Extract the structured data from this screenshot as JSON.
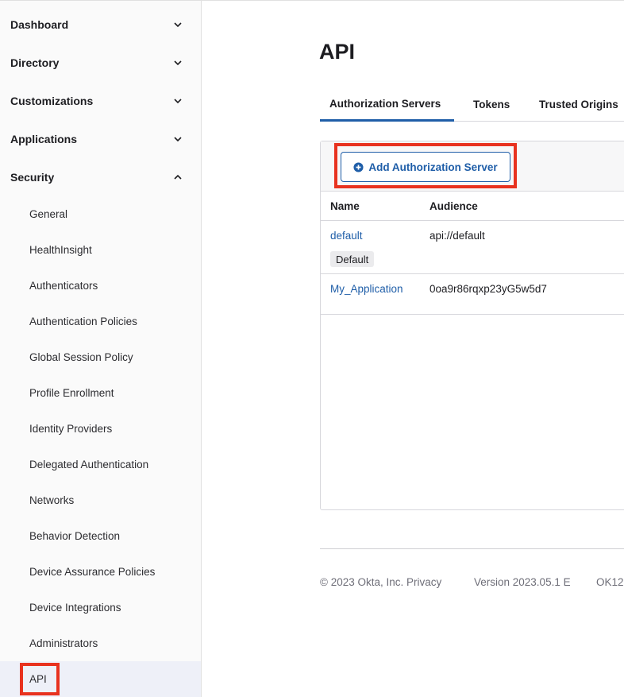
{
  "sidebar": {
    "sections": [
      {
        "label": "Dashboard",
        "expanded": false
      },
      {
        "label": "Directory",
        "expanded": false
      },
      {
        "label": "Customizations",
        "expanded": false
      },
      {
        "label": "Applications",
        "expanded": false
      },
      {
        "label": "Security",
        "expanded": true
      }
    ],
    "security_items": [
      {
        "label": "General"
      },
      {
        "label": "HealthInsight"
      },
      {
        "label": "Authenticators"
      },
      {
        "label": "Authentication Policies"
      },
      {
        "label": "Global Session Policy"
      },
      {
        "label": "Profile Enrollment"
      },
      {
        "label": "Identity Providers"
      },
      {
        "label": "Delegated Authentication"
      },
      {
        "label": "Networks"
      },
      {
        "label": "Behavior Detection"
      },
      {
        "label": "Device Assurance Policies"
      },
      {
        "label": "Device Integrations"
      },
      {
        "label": "Administrators"
      },
      {
        "label": "API",
        "active": true
      }
    ]
  },
  "main": {
    "title": "API",
    "tabs": [
      {
        "label": "Authorization Servers",
        "active": true
      },
      {
        "label": "Tokens"
      },
      {
        "label": "Trusted Origins"
      }
    ],
    "add_button": {
      "label": "Add Authorization Server",
      "icon": "plus-circle-icon"
    },
    "table": {
      "columns": [
        "Name",
        "Audience"
      ],
      "rows": [
        {
          "name": "default",
          "audience": "api://default",
          "badge": "Default"
        },
        {
          "name": "My_Application",
          "audience": "0oa9r86rqxp23yG5w5d7"
        }
      ]
    }
  },
  "footer": {
    "copyright": "© 2023 Okta, Inc. Privacy",
    "version": "Version 2023.05.1 E",
    "cell": "OK12"
  },
  "colors": {
    "accent": "#1f5ea8",
    "highlight": "#e8321f",
    "active_nav_bg": "#eef0f8"
  }
}
